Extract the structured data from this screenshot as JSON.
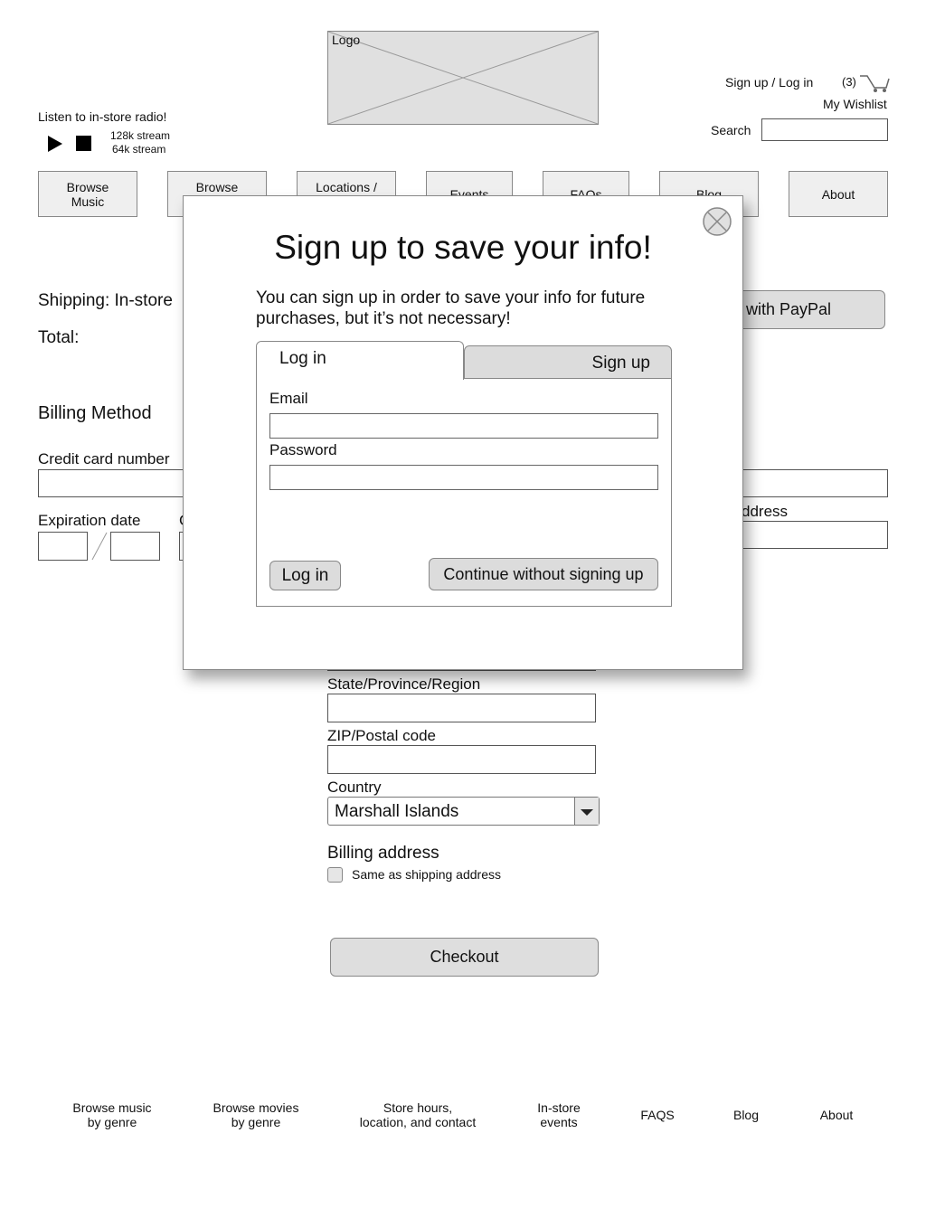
{
  "header": {
    "logo_label": "Logo",
    "radio": {
      "title": "Listen to in-store radio!",
      "stream_128": "128k stream",
      "stream_64": "64k stream"
    },
    "signup_login": "Sign up / Log in",
    "cart_count": "(3)",
    "wishlist": "My Wishlist",
    "search_label": "Search",
    "search_value": ""
  },
  "nav": [
    "Browse\nMusic",
    "Browse",
    "Locations /",
    "Events",
    "FAQs",
    "Blog",
    "About"
  ],
  "checkout": {
    "shipping_label": "Shipping: In-store",
    "total_label": "Total:",
    "paypal_button": "with PayPal",
    "billing_method": "Billing Method",
    "credit_card_label": "Credit card number",
    "expiration_label": "Expiration date",
    "cvv_partial": "C",
    "address_partial": "ddress",
    "state_label": "State/Province/Region",
    "zip_label": "ZIP/Postal code",
    "country_label": "Country",
    "country_value": "Marshall Islands",
    "billing_address_label": "Billing address",
    "same_as_shipping": "Same as shipping address",
    "checkout_button": "Checkout"
  },
  "modal": {
    "title": "Sign up to save your info!",
    "description": "You can sign up in order to save your info for future purchases, but it’s not necessary!",
    "tab_login": "Log in",
    "tab_signup": "Sign up",
    "email_label": "Email",
    "email_value": "",
    "password_label": "Password",
    "password_value": "",
    "login_button": "Log in",
    "continue_button": "Continue without signing up"
  },
  "footer": [
    "Browse music\nby genre",
    "Browse movies\nby genre",
    "Store hours,\nlocation, and contact",
    "In-store\nevents",
    "FAQS",
    "Blog",
    "About"
  ]
}
